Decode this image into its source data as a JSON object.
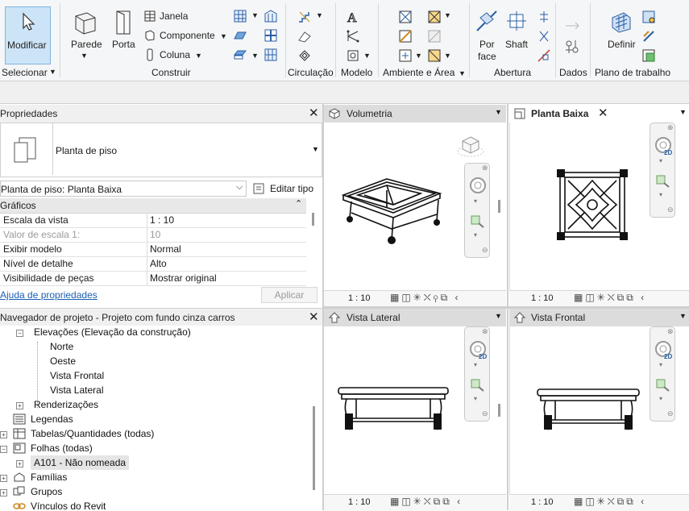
{
  "ribbon": {
    "modify_label": "Modificar",
    "select_label": "Selecionar",
    "parede_label": "Parede",
    "porta_label": "Porta",
    "janela_label": "Janela",
    "componente_label": "Componente",
    "coluna_label": "Coluna",
    "construir_label": "Construir",
    "circulacao_label": "Circulação",
    "modelo_label": "Modelo",
    "ambiente_label": "Ambiente e Área",
    "por_label": "Por",
    "face_label": "face",
    "shaft_label": "Shaft",
    "abertura_label": "Abertura",
    "dados_label": "Dados",
    "definir_label": "Definir",
    "plano_label": "Plano de trabalho"
  },
  "properties": {
    "title": "Propriedades",
    "type_name": "Planta de piso",
    "instance": "Planta de piso: Planta Baixa",
    "edit_type": "Editar tipo",
    "section": "Gráficos",
    "rows": [
      {
        "k": "Escala da vista",
        "v": "1 : 10"
      },
      {
        "k": "Valor de escala    1:",
        "v": "10"
      },
      {
        "k": "Exibir modelo",
        "v": "Normal"
      },
      {
        "k": "Nível de detalhe",
        "v": "Alto"
      },
      {
        "k": "Visibilidade de peças",
        "v": "Mostrar original"
      }
    ],
    "help_link": "Ajuda de propriedades",
    "apply": "Aplicar"
  },
  "browser": {
    "title": "Navegador de projeto - Projeto com fundo cinza carros",
    "items": [
      "Elevações (Elevação da construção)",
      "Norte",
      "Oeste",
      "Vista Frontal",
      "Vista Lateral",
      "Renderizações",
      "Legendas",
      "Tabelas/Quantidades (todas)",
      "Folhas (todas)",
      "A101 - Não nomeada",
      "Famílias",
      "Grupos",
      "Vínculos do Revit"
    ]
  },
  "views": {
    "volumetria": "Volumetria",
    "planta": "Planta Baixa",
    "lateral": "Vista Lateral",
    "frontal": "Vista Frontal",
    "scale": "1 : 10",
    "nav_2d": "2D"
  }
}
